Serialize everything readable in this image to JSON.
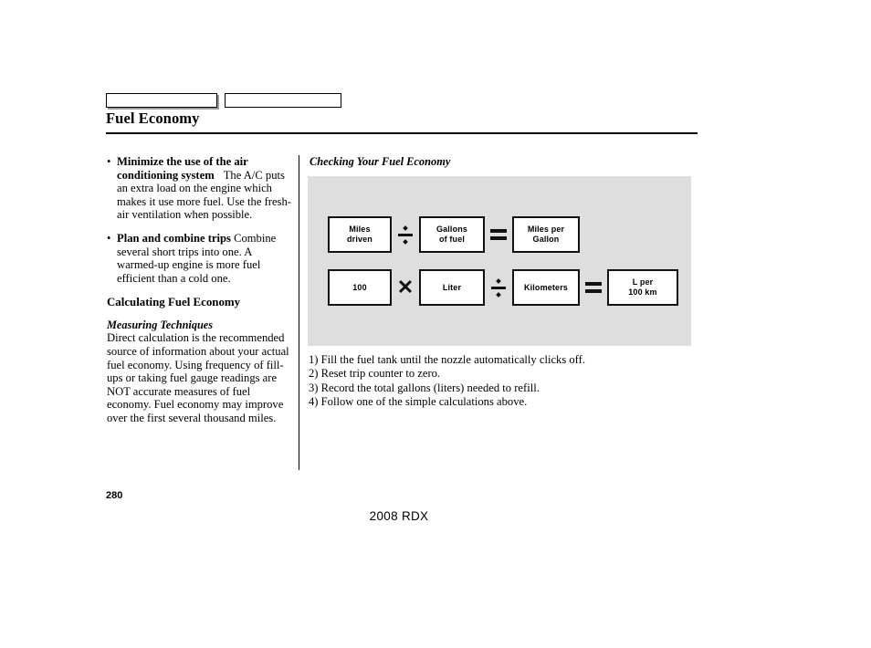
{
  "page": {
    "title": "Fuel Economy",
    "page_number": "280",
    "footer_model": "2008  RDX"
  },
  "tabs": [
    {
      "label": ""
    },
    {
      "label": ""
    }
  ],
  "left_column": {
    "bullets": [
      {
        "marker": "•",
        "lead": "Minimize the use of the air conditioning system",
        "text": "The A/C puts an extra load on the engine which makes it use more fuel. Use the fresh-air ventilation when possible."
      },
      {
        "marker": "•",
        "lead": "Plan and combine trips",
        "text": "Combine several short trips into one. A warmed-up engine is more fuel efficient than a cold one."
      }
    ],
    "section_heading": "Calculating Fuel Economy",
    "subsection_heading": "Measuring Techniques",
    "body": "Direct calculation is the recommended source of information about your actual fuel economy. Using frequency of fill-ups or taking fuel gauge readings are NOT accurate measures of fuel economy. Fuel economy may improve over the first several thousand miles."
  },
  "right_column": {
    "figure_heading": "Checking Your Fuel Economy",
    "panel_color": "#dedede",
    "formula_rows": [
      {
        "terms": [
          {
            "kind": "box",
            "lines": [
              "Miles",
              "driven"
            ],
            "width": "w70"
          },
          {
            "kind": "op",
            "op": "divide"
          },
          {
            "kind": "box",
            "lines": [
              "Gallons",
              "of fuel"
            ],
            "width": "w72"
          },
          {
            "kind": "op",
            "op": "equals"
          },
          {
            "kind": "box",
            "lines": [
              "Miles per",
              "Gallon"
            ],
            "width": "w74"
          }
        ]
      },
      {
        "terms": [
          {
            "kind": "box",
            "lines": [
              "100"
            ],
            "width": "w70"
          },
          {
            "kind": "op",
            "op": "multiply"
          },
          {
            "kind": "box",
            "lines": [
              "Liter"
            ],
            "width": "w72"
          },
          {
            "kind": "op",
            "op": "divide"
          },
          {
            "kind": "box",
            "lines": [
              "Kilometers"
            ],
            "width": "w74"
          },
          {
            "kind": "op",
            "op": "equals"
          },
          {
            "kind": "box",
            "lines": [
              "L per",
              "100 km"
            ],
            "width": "w78"
          }
        ]
      }
    ],
    "steps": [
      "1) Fill the fuel tank until the nozzle automatically clicks off.",
      "2) Reset trip counter to zero.",
      "3) Record the total gallons (liters) needed to refill.",
      "4) Follow one of the simple calculations above."
    ]
  }
}
